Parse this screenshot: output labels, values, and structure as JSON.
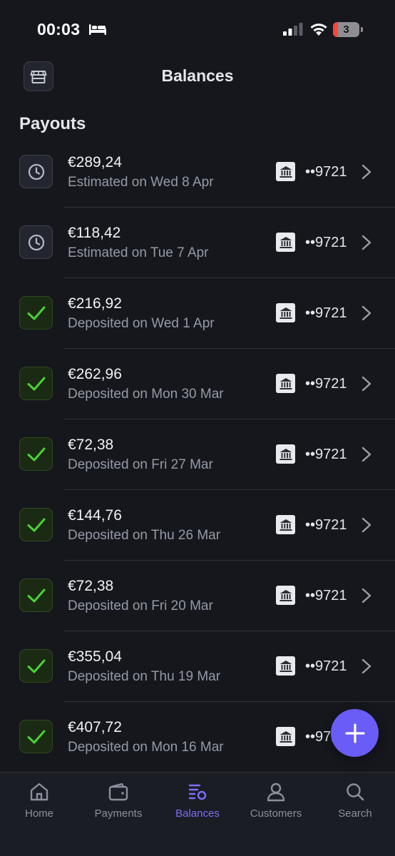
{
  "status_bar": {
    "time": "00:03",
    "battery": "3"
  },
  "header": {
    "title": "Balances"
  },
  "section": {
    "title": "Payouts"
  },
  "payouts": [
    {
      "amount": "€289,24",
      "date": "Estimated on Wed 8 Apr",
      "status": "pending",
      "account": "••9721"
    },
    {
      "amount": "€118,42",
      "date": "Estimated on Tue 7 Apr",
      "status": "pending",
      "account": "••9721"
    },
    {
      "amount": "€216,92",
      "date": "Deposited on Wed 1 Apr",
      "status": "deposited",
      "account": "••9721"
    },
    {
      "amount": "€262,96",
      "date": "Deposited on Mon 30 Mar",
      "status": "deposited",
      "account": "••9721"
    },
    {
      "amount": "€72,38",
      "date": "Deposited on Fri 27 Mar",
      "status": "deposited",
      "account": "••9721"
    },
    {
      "amount": "€144,76",
      "date": "Deposited on Thu 26 Mar",
      "status": "deposited",
      "account": "••9721"
    },
    {
      "amount": "€72,38",
      "date": "Deposited on Fri 20 Mar",
      "status": "deposited",
      "account": "••9721"
    },
    {
      "amount": "€355,04",
      "date": "Deposited on Thu 19 Mar",
      "status": "deposited",
      "account": "••9721"
    },
    {
      "amount": "€407,72",
      "date": "Deposited on Mon 16 Mar",
      "status": "deposited",
      "account": "••9721"
    }
  ],
  "tabs": [
    {
      "label": "Home",
      "icon": "home-icon",
      "active": false
    },
    {
      "label": "Payments",
      "icon": "wallet-icon",
      "active": false
    },
    {
      "label": "Balances",
      "icon": "balances-icon",
      "active": true
    },
    {
      "label": "Customers",
      "icon": "person-icon",
      "active": false
    },
    {
      "label": "Search",
      "icon": "search-icon",
      "active": false
    }
  ],
  "colors": {
    "background": "#15171d",
    "accent": "#6a5cf6",
    "success": "#4cd137",
    "muted_text": "#959aa6"
  }
}
